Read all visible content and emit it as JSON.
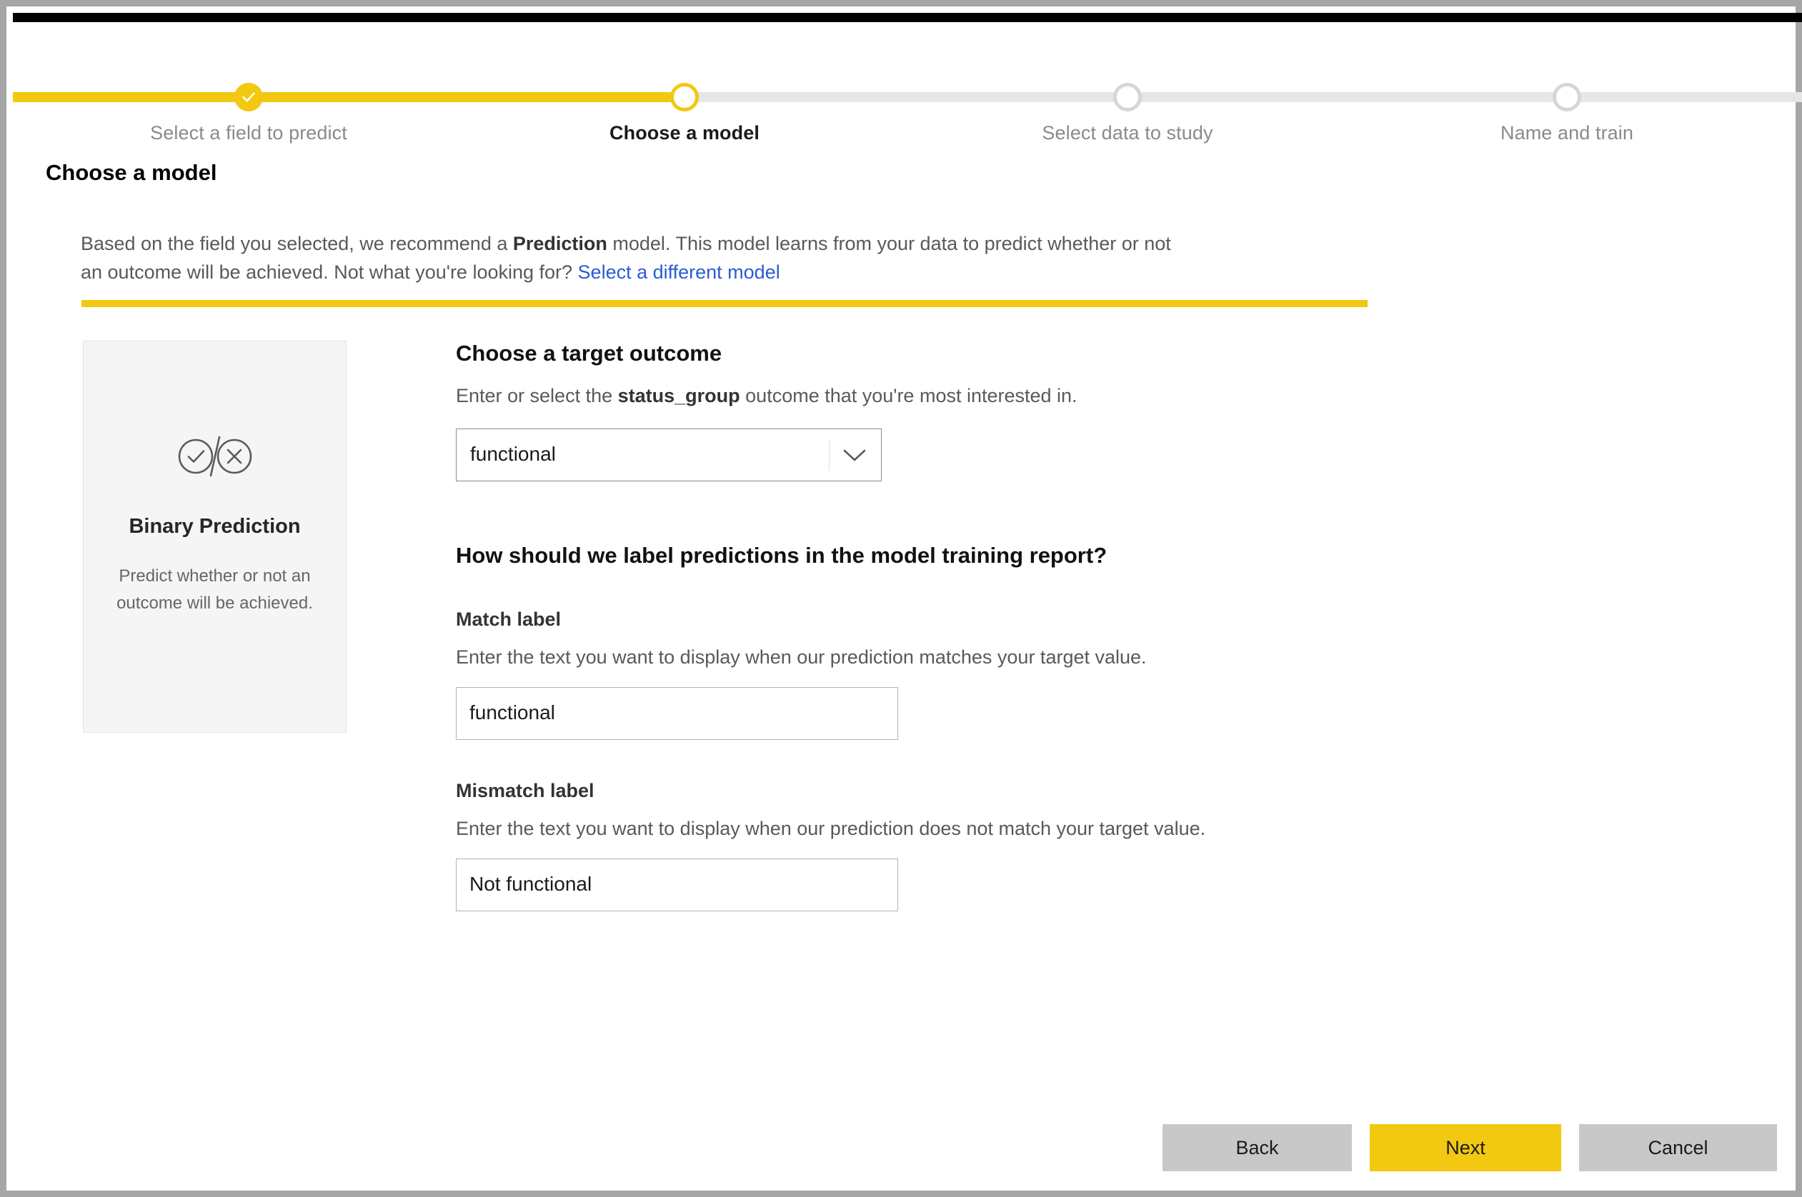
{
  "wizard": {
    "steps": [
      {
        "label": "Select a field to predict",
        "state": "done"
      },
      {
        "label": "Choose a model",
        "state": "current"
      },
      {
        "label": "Select data to study",
        "state": "upcoming"
      },
      {
        "label": "Name and train",
        "state": "upcoming"
      }
    ]
  },
  "page": {
    "title": "Choose a model"
  },
  "description": {
    "part1": "Based on the field you selected, we recommend a ",
    "emphasis": "Prediction",
    "part2": " model. This model learns from your data to predict whether or not an outcome will be achieved. Not what you're looking for? ",
    "link": "Select a different model"
  },
  "model_card": {
    "icon": "check-cross-circle-icon",
    "title": "Binary Prediction",
    "description": "Predict whether or not an outcome will be achieved."
  },
  "target_outcome": {
    "title": "Choose a target outcome",
    "hint_before": "Enter or select the ",
    "hint_field": "status_group",
    "hint_after": " outcome that you're most interested in.",
    "value": "functional",
    "placeholder": "Select an outcome",
    "chevron_icon": "chevron-down-icon"
  },
  "labels_section": {
    "title": "How should we label predictions in the model training report?",
    "match": {
      "label": "Match label",
      "hint": "Enter the text you want to display when our prediction matches your target value.",
      "value": "functional",
      "placeholder": "Enter a match label"
    },
    "mismatch": {
      "label": "Mismatch label",
      "hint": "Enter the text you want to display when our prediction does not match your target value.",
      "value": "Not functional",
      "placeholder": "Enter a mismatch label"
    }
  },
  "footer": {
    "back": "Back",
    "next": "Next",
    "cancel": "Cancel"
  },
  "colors": {
    "accent": "#f2c811",
    "link": "#2a5bd7",
    "track_inactive": "#e6e6e6",
    "button_neutral": "#c8c8c8"
  }
}
